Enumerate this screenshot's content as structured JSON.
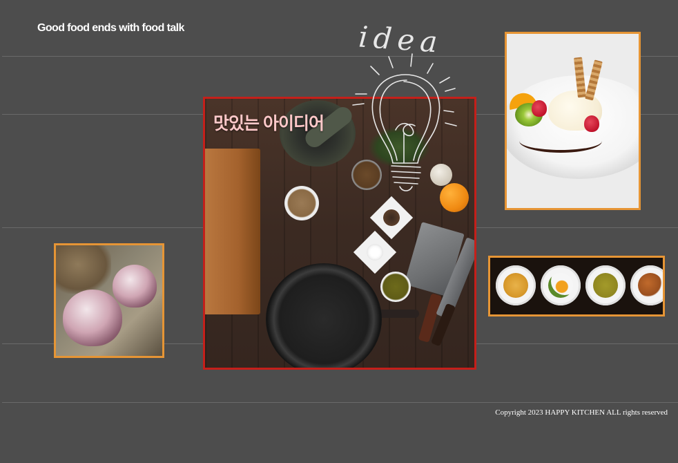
{
  "header": {
    "title": "Good food ends with food talk"
  },
  "gallery": {
    "main_image": {
      "caption": "맛있는 아이디어",
      "subject": "kitchen-table-still-life"
    },
    "doodle_word": "idea",
    "side_images": [
      {
        "subject": "dessert-plate"
      },
      {
        "subject": "garlic-bulbs"
      },
      {
        "subject": "four-dishes"
      }
    ]
  },
  "footer": {
    "copyright": "Copyright 2023 HAPPY KITCHEN ALL rights reserved"
  },
  "colors": {
    "background": "#4d4d4d",
    "divider": "#6a6a6a",
    "frame_orange": "#e69535",
    "frame_red": "#c51f1a",
    "caption_pink": "#ffc9c9"
  }
}
